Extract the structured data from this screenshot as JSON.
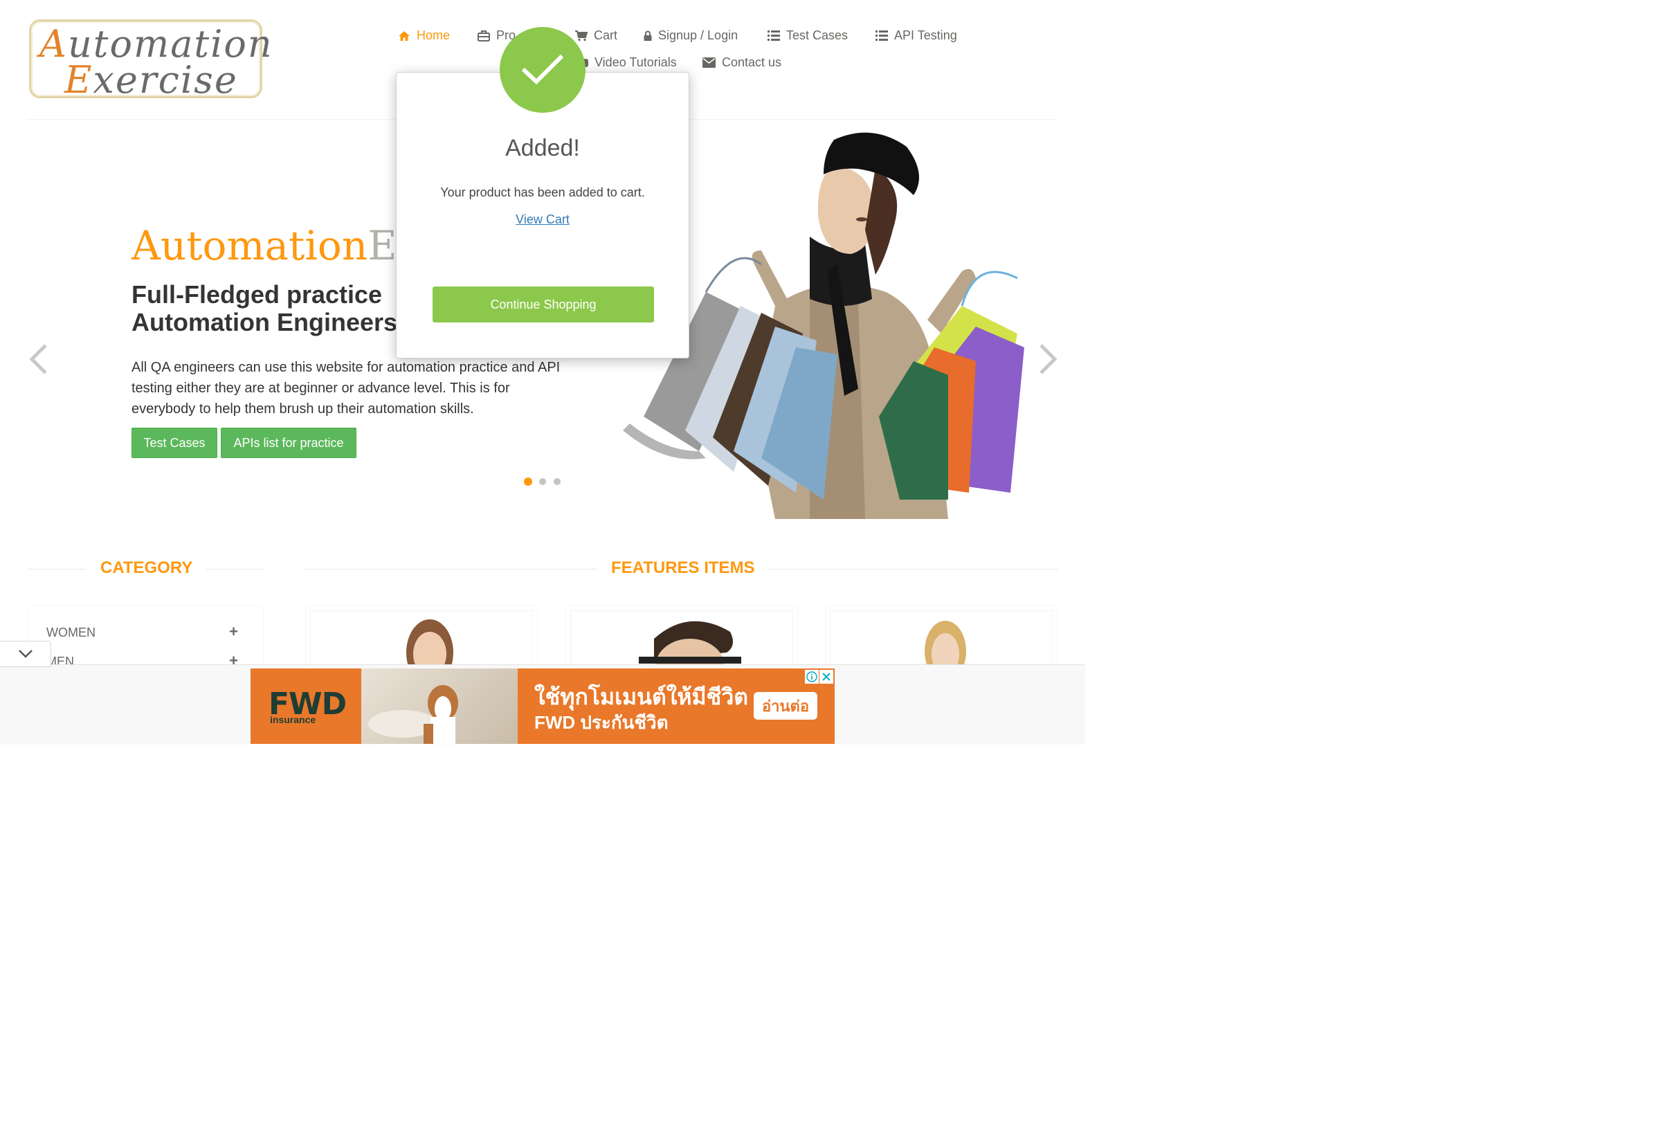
{
  "logo": {
    "line1_cap": "A",
    "line1_rest": "utomation",
    "line2_cap": "E",
    "line2_rest": "xercise"
  },
  "nav": {
    "home": "Home",
    "products": "Pro",
    "cart": "Cart",
    "signup": "Signup / Login",
    "test_cases": "Test Cases",
    "api_testing": "API Testing",
    "video": "Video Tutorials",
    "contact": "Contact us"
  },
  "hero": {
    "brand_a": "Automation",
    "brand_b": "Exe",
    "heading_line1": "Full-Fledged practice",
    "heading_line2": "Automation Engineers",
    "paragraph": "All QA engineers can use this website for automation practice and API testing either they are at beginner or advance level. This is for everybody to help them brush up their automation skills.",
    "btn_test_cases": "Test Cases",
    "btn_apis": "APIs list for practice",
    "active_slide": 1,
    "slide_count": 3
  },
  "sections": {
    "category": "CATEGORY",
    "features": "FEATURES ITEMS"
  },
  "categories": [
    {
      "label": "WOMEN"
    },
    {
      "label": "MEN"
    }
  ],
  "modal": {
    "title": "Added!",
    "body": "Your product has been added to cart.",
    "link": "View Cart",
    "button": "Continue Shopping"
  },
  "ad": {
    "brand": "FWD",
    "brand_sub": "insurance",
    "line1": "ใช้ทุกโมเมนต์ให้มีชีวิต",
    "line2": "FWD ประกันชีวิต",
    "cta": "อ่านต่อ"
  },
  "colors": {
    "accent": "#fe980f",
    "green": "#5cb85c",
    "modal_green": "#8cc84b",
    "ad_orange": "#e9782a"
  }
}
